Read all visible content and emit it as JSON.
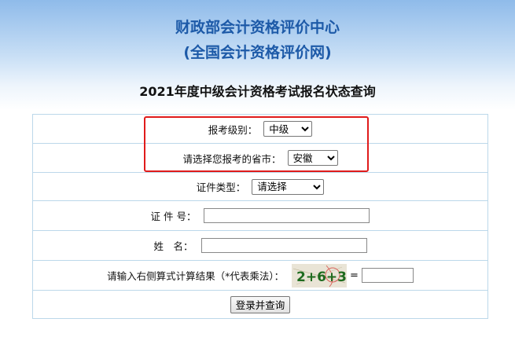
{
  "header": {
    "line1": "财政部会计资格评价中心",
    "line2": "(全国会计资格评价网)",
    "title": "2021年度中级会计资格考试报名状态查询"
  },
  "form": {
    "level_label": "报考级别：",
    "level_value": "中级",
    "province_label": "请选择您报考的省市：",
    "province_value": "安徽",
    "idtype_label": "证件类型：",
    "idtype_value": "请选择",
    "idno_label": "证 件 号：",
    "idno_value": "",
    "name_label": "姓　名：",
    "name_value": "",
    "captcha_label": "请输入右侧算式计算结果（*代表乘法）：",
    "captcha_text": "2+6+3",
    "captcha_equals": "=",
    "captcha_value": "",
    "submit_label": "登录并查询"
  },
  "colors": {
    "header_text": "#1d5aa8",
    "highlight_box": "#e01b1b",
    "table_border": "#bcd8ea"
  }
}
